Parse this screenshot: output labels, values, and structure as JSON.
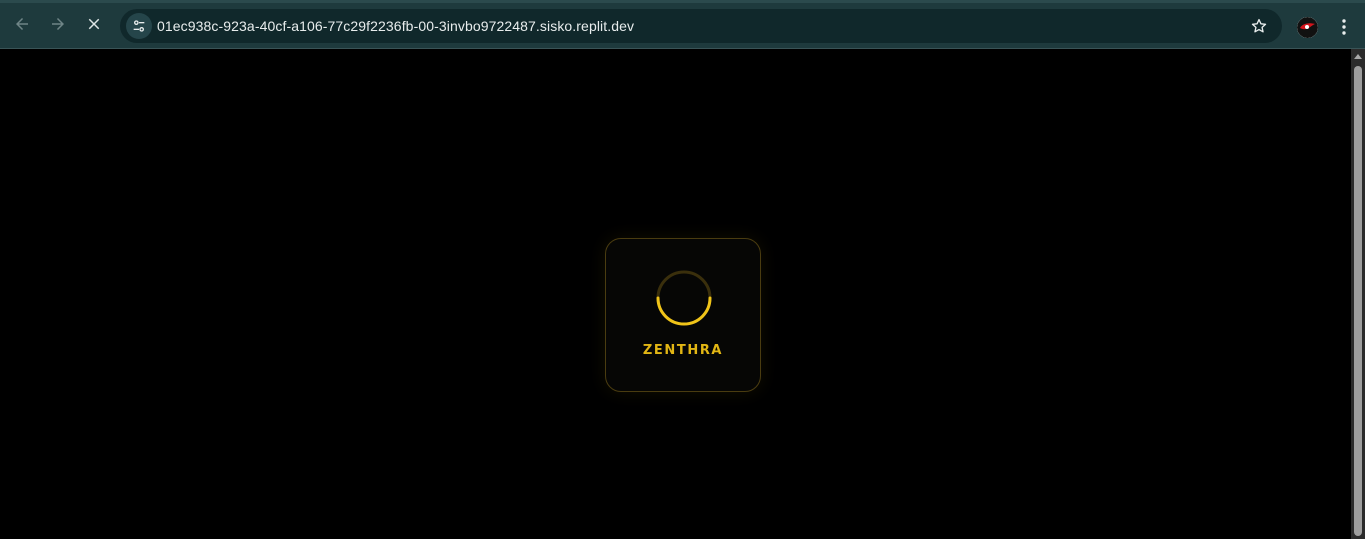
{
  "browser": {
    "url": "01ec938c-923a-40cf-a106-77c29f2236fb-00-3invbo9722487.sisko.replit.dev",
    "icons": {
      "back": "arrow-left-icon",
      "forward": "arrow-right-icon",
      "stop": "close-icon",
      "site_info": "tune-icon",
      "bookmark": "star-icon",
      "menu": "kebab-menu-icon"
    }
  },
  "loader": {
    "brand": "ZENTHRA",
    "accent_color": "#e2b614"
  }
}
